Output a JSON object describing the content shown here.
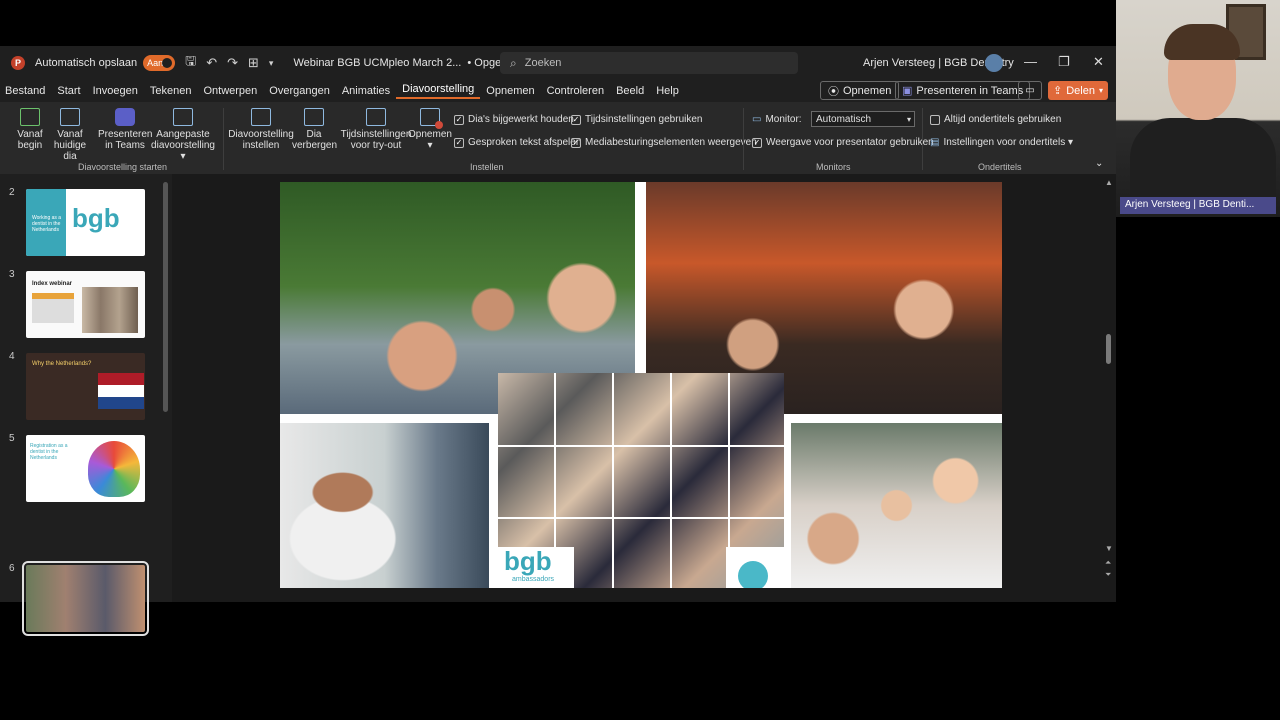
{
  "titlebar": {
    "autosave_label": "Automatisch opslaan",
    "toggle_label": "Aan",
    "document_title": "Webinar BGB UCMpleo March 2...",
    "saved_status": "• Opgeslagen",
    "search_placeholder": "Zoeken",
    "user_name": "Arjen Versteeg | BGB Dentistry"
  },
  "menu": {
    "items": [
      "Bestand",
      "Start",
      "Invoegen",
      "Tekenen",
      "Ontwerpen",
      "Overgangen",
      "Animaties",
      "Diavoorstelling",
      "Opnemen",
      "Controleren",
      "Beeld",
      "Help"
    ],
    "active": "Diavoorstelling",
    "record_button": "Opnemen",
    "present_teams_button": "Presenteren in Teams",
    "share_button": "Delen"
  },
  "ribbon": {
    "start_group": {
      "label": "Diavoorstelling starten",
      "from_start": [
        "Vanaf",
        "begin"
      ],
      "from_current": [
        "Vanaf",
        "huidige dia"
      ],
      "present_teams": [
        "Presenteren",
        "in Teams"
      ],
      "custom": [
        "Aangepaste",
        "diavoorstelling ▾"
      ]
    },
    "setup_group": {
      "label": "Instellen",
      "setup": [
        "Diavoorstelling",
        "instellen"
      ],
      "hide": [
        "Dia",
        "verbergen"
      ],
      "rehearse": [
        "Tijdsinstellingen",
        "voor try-out"
      ],
      "record": [
        "Opnemen",
        "▾"
      ],
      "checks": [
        {
          "label": "Dia's bijgewerkt houden",
          "checked": true
        },
        {
          "label": "Tijdsinstellingen gebruiken",
          "checked": true
        },
        {
          "label": "Gesproken tekst afspelen",
          "checked": true
        },
        {
          "label": "Mediabesturingselementen weergeven",
          "checked": true
        }
      ]
    },
    "monitors_group": {
      "label": "Monitors",
      "monitor_label": "Monitor:",
      "monitor_value": "Automatisch",
      "presenter_view": "Weergave voor presentator gebruiken",
      "presenter_checked": true
    },
    "captions_group": {
      "label": "Ondertitels",
      "always_captions": "Altijd ondertitels gebruiken",
      "always_checked": false,
      "caption_settings": "Instellingen voor ondertitels ▾"
    }
  },
  "thumbnails": [
    {
      "number": "2",
      "title": "Working as a dentist in the Netherlands",
      "logo": "bgb"
    },
    {
      "number": "3",
      "title": "Index webinar"
    },
    {
      "number": "4",
      "title": "Why the Netherlands?"
    },
    {
      "number": "5",
      "title": "Registration as a dentist in the Netherlands"
    },
    {
      "number": "6",
      "title": "",
      "selected": true
    }
  ],
  "slide": {
    "logo_text": "bgb",
    "logo_subtext": "ambassadors"
  },
  "webcam": {
    "name_tag": "Arjen Versteeg | BGB Denti..."
  },
  "colors": {
    "accent": "#e0693a",
    "window_bg": "#1f1f1f",
    "ribbon_bg": "#292929",
    "bgb_teal": "#3aa7b8"
  }
}
